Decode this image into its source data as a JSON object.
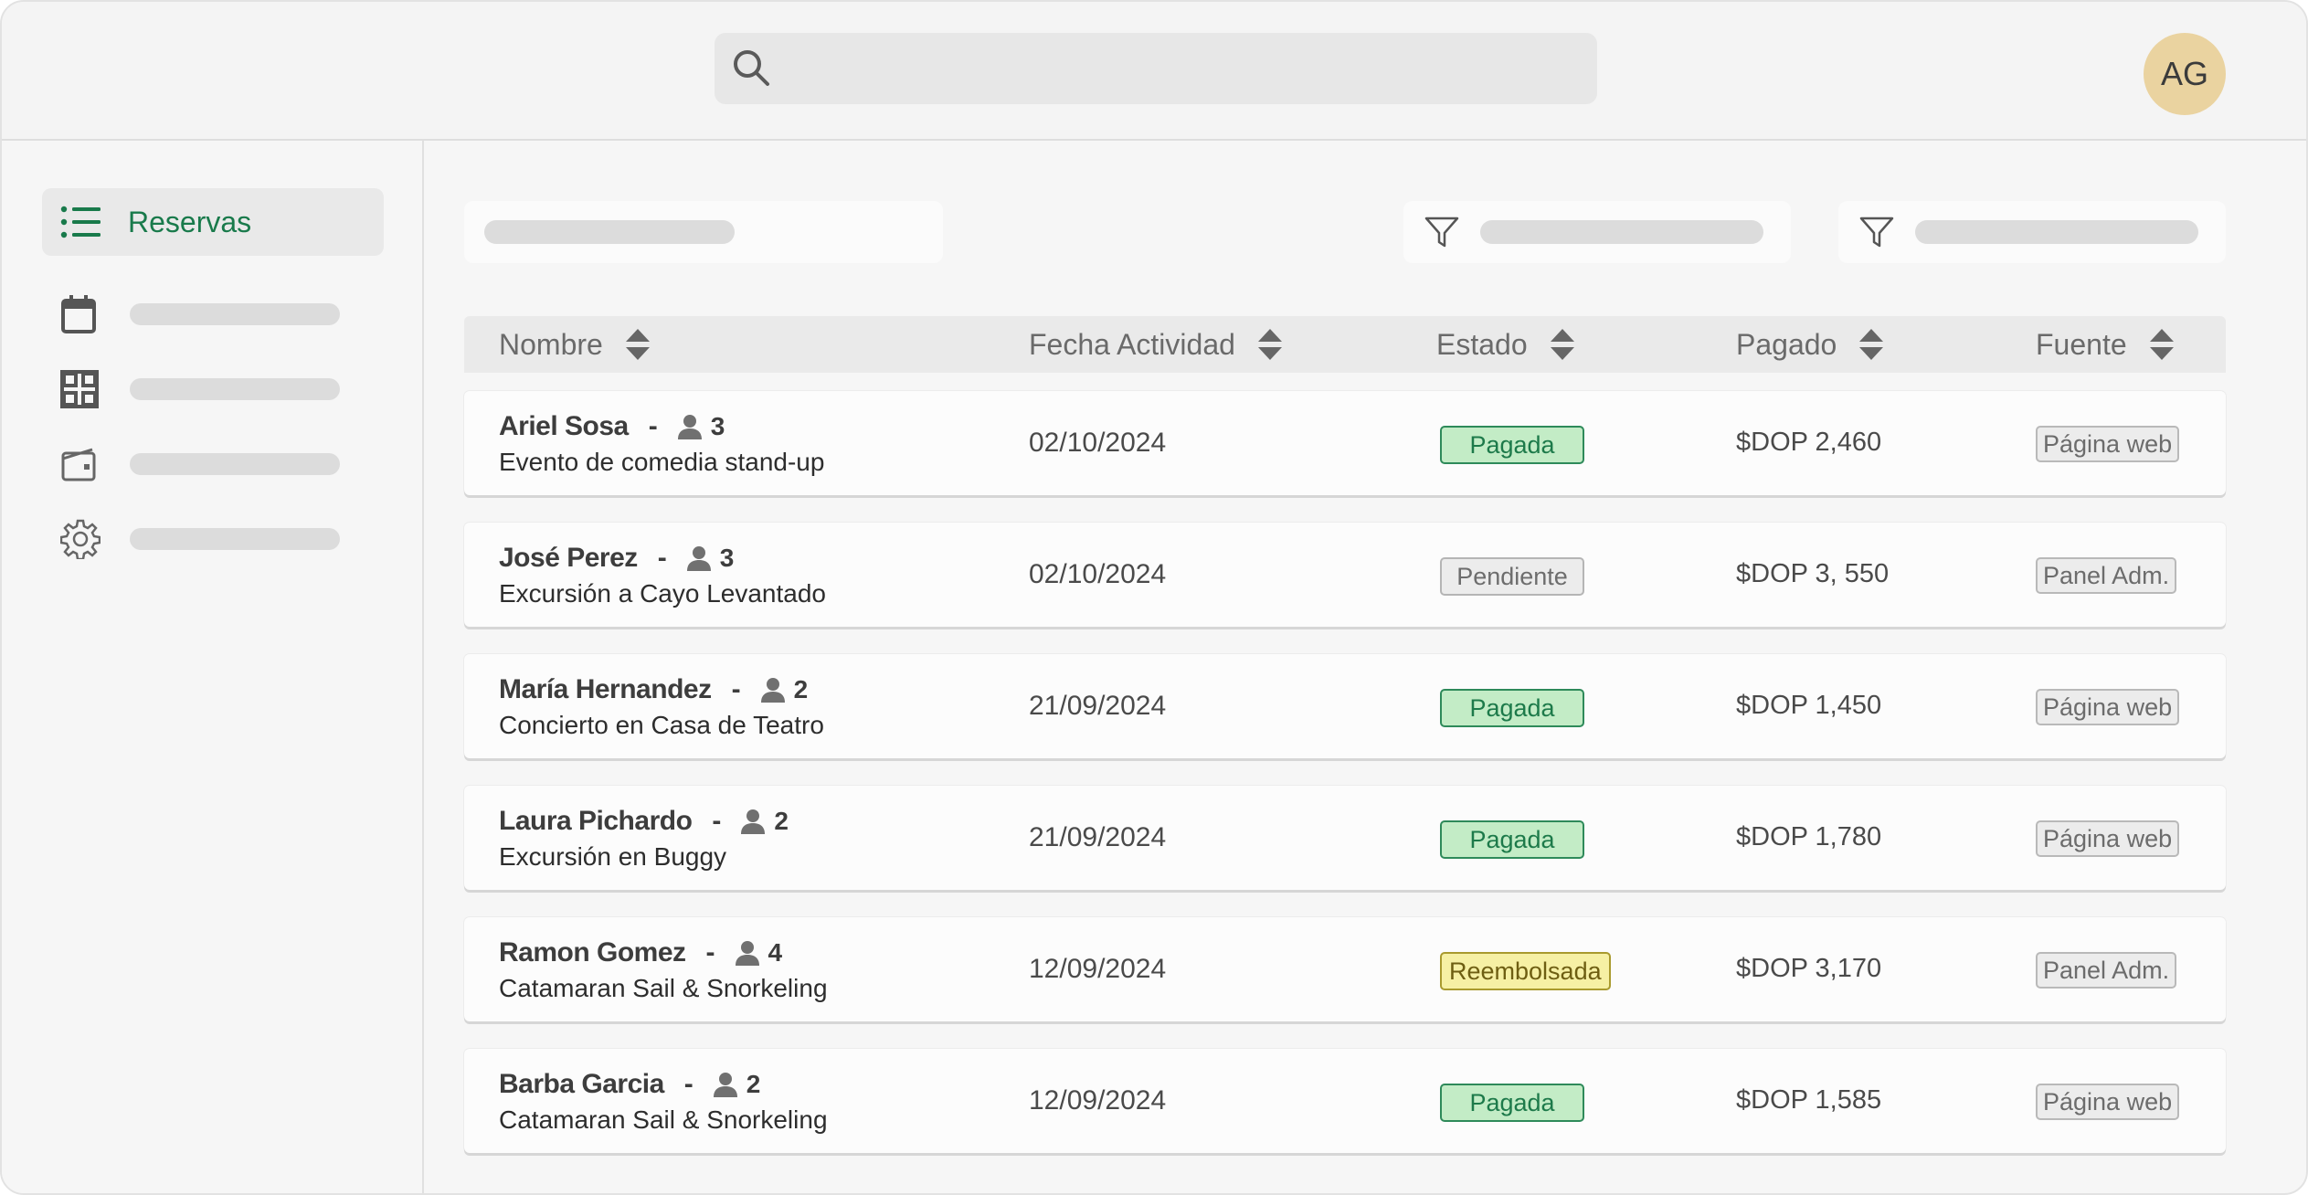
{
  "header": {
    "search_placeholder": "",
    "avatar_initials": "AG"
  },
  "sidebar": {
    "active_item": {
      "label": "Reservas",
      "icon": "list-icon"
    },
    "items": [
      {
        "icon": "calendar-icon"
      },
      {
        "icon": "grid-icon"
      },
      {
        "icon": "wallet-icon"
      },
      {
        "icon": "gear-icon"
      }
    ]
  },
  "filters": [
    {
      "icon": "search-filter"
    },
    {
      "icon": "filter-icon"
    },
    {
      "icon": "filter-icon"
    }
  ],
  "table": {
    "columns": [
      "Nombre",
      "Fecha Actividad",
      "Estado",
      "Pagado",
      "Fuente"
    ],
    "rows": [
      {
        "name": "Ariel Sosa",
        "people": "3",
        "activity": "Evento de comedia stand-up",
        "date": "02/10/2024",
        "status": "Pagada",
        "status_type": "paid",
        "amount": "$DOP 2,460",
        "source": "Página web"
      },
      {
        "name": "José Perez",
        "people": "3",
        "activity": "Excursión a Cayo Levantado",
        "date": "02/10/2024",
        "status": "Pendiente",
        "status_type": "pending",
        "amount": "$DOP 3, 550",
        "source": "Panel Adm."
      },
      {
        "name": "María Hernandez",
        "people": "2",
        "activity": "Concierto en Casa de Teatro",
        "date": "21/09/2024",
        "status": "Pagada",
        "status_type": "paid",
        "amount": "$DOP 1,450",
        "source": "Página web"
      },
      {
        "name": "Laura Pichardo",
        "people": "2",
        "activity": "Excursión en Buggy",
        "date": "21/09/2024",
        "status": "Pagada",
        "status_type": "paid",
        "amount": "$DOP 1,780",
        "source": "Página web"
      },
      {
        "name": "Ramon Gomez",
        "people": "4",
        "activity": "Catamaran Sail & Snorkeling",
        "date": "12/09/2024",
        "status": "Reembolsada",
        "status_type": "refunded",
        "amount": "$DOP 3,170",
        "source": "Panel Adm."
      },
      {
        "name": "Barba Garcia",
        "people": "2",
        "activity": "Catamaran Sail & Snorkeling",
        "date": "12/09/2024",
        "status": "Pagada",
        "status_type": "paid",
        "amount": "$DOP 1,585",
        "source": "Página web"
      }
    ]
  },
  "colors": {
    "accent_green": "#197a4b",
    "paid_bg": "#c3ecc6",
    "refunded_bg": "#f6f0a4",
    "avatar_bg": "#ead3a0"
  }
}
